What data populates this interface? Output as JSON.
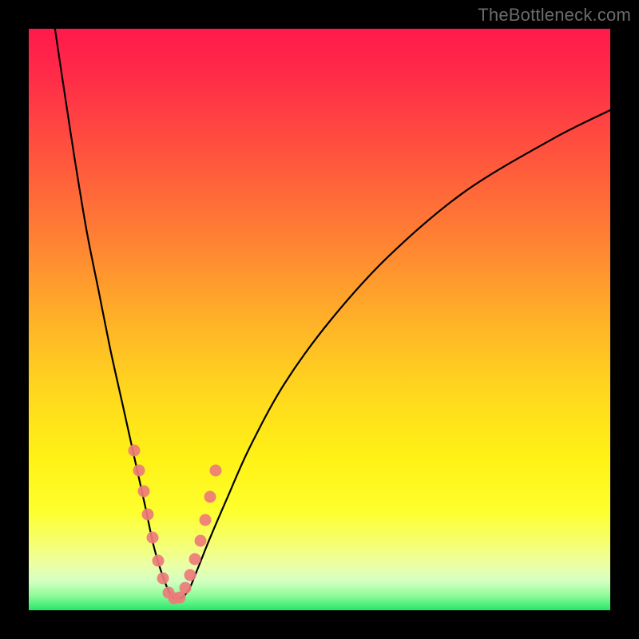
{
  "watermark": {
    "text": "TheBottleneck.com"
  },
  "colors": {
    "bg_black": "#000000",
    "curve": "#000000",
    "dot": "#ed7b7a",
    "gradient_stops": [
      {
        "offset": 0.0,
        "color": "#ff1a4b"
      },
      {
        "offset": 0.08,
        "color": "#ff2b48"
      },
      {
        "offset": 0.2,
        "color": "#ff4f3f"
      },
      {
        "offset": 0.35,
        "color": "#ff7d34"
      },
      {
        "offset": 0.5,
        "color": "#ffb128"
      },
      {
        "offset": 0.62,
        "color": "#ffd61e"
      },
      {
        "offset": 0.74,
        "color": "#fff215"
      },
      {
        "offset": 0.83,
        "color": "#feff2e"
      },
      {
        "offset": 0.88,
        "color": "#f6ff6a"
      },
      {
        "offset": 0.92,
        "color": "#ecffa3"
      },
      {
        "offset": 0.95,
        "color": "#d4ffc2"
      },
      {
        "offset": 0.975,
        "color": "#8efc9a"
      },
      {
        "offset": 1.0,
        "color": "#28e66b"
      }
    ]
  },
  "chart_data": {
    "type": "line",
    "title": "",
    "xlabel": "",
    "ylabel": "",
    "xlim": [
      0,
      100
    ],
    "ylim": [
      0,
      100
    ],
    "grid": false,
    "note": "x and y in percent of plot area; y=0 is bottom (green), y=100 is top (red). Curve is an asymmetric V with minimum near x≈25.",
    "series": [
      {
        "name": "bottleneck-curve",
        "x": [
          4.5,
          6,
          8,
          10,
          12,
          14,
          16,
          18,
          20,
          21.5,
          23,
          24.5,
          26,
          27.5,
          29,
          31,
          34,
          38,
          44,
          52,
          62,
          75,
          90,
          100
        ],
        "y": [
          100,
          90,
          77,
          65,
          55,
          45,
          36,
          27,
          18,
          11,
          6,
          2.5,
          2,
          3.5,
          7,
          12,
          19,
          28,
          39,
          50,
          61,
          72,
          81,
          86
        ]
      },
      {
        "name": "highlight-dots",
        "type": "scatter",
        "x": [
          18.2,
          18.9,
          19.8,
          20.5,
          21.3,
          22.2,
          23.1,
          24.0,
          25.0,
          26.0,
          26.9,
          27.8,
          28.6,
          29.5,
          30.3,
          31.2,
          32.2
        ],
        "y": [
          27.5,
          24.0,
          20.5,
          16.5,
          12.5,
          8.5,
          5.5,
          3.0,
          2.0,
          2.2,
          3.8,
          6.0,
          8.8,
          12.0,
          15.5,
          19.5,
          24.0
        ]
      }
    ]
  }
}
